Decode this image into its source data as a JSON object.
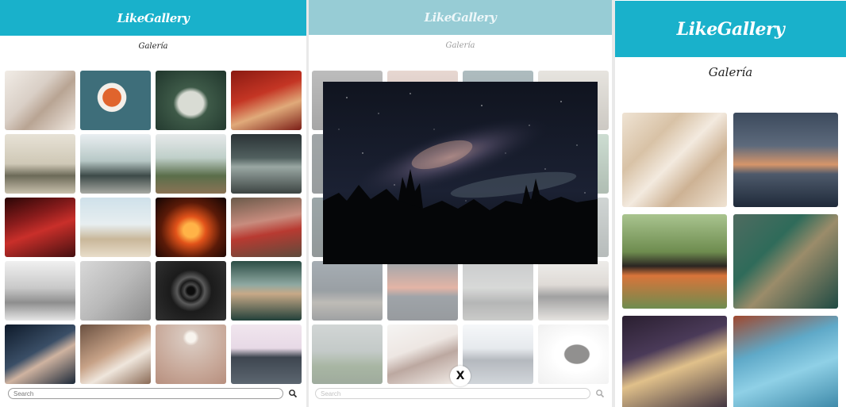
{
  "app": {
    "brand": "LikeGallery",
    "subtitle": "Galería"
  },
  "search": {
    "placeholder": "Search",
    "icon": "search-icon"
  },
  "modal": {
    "close_label": "X",
    "image_subject": "milky way night sky"
  },
  "gallery_desktop": [
    {
      "subject": "skincare products flatlay",
      "bg": "linear-gradient(135deg,#f1ece6 0%,#d9cfc6 40%,#b8a493 60%,#efe7df 100%)"
    },
    {
      "subject": "soup bowl with food",
      "bg": "radial-gradient(circle at 45% 45%,#e0642d 0 18%,#f4efe9 19% 28%,#3e6e7a 29% 100%)"
    },
    {
      "subject": "white owl",
      "bg": "radial-gradient(ellipse at 50% 55%,#d9dcd4 0 25%,#3e5a48 35%,#20362c 100%)"
    },
    {
      "subject": "women on red couch",
      "bg": "linear-gradient(160deg,#8a1a12 0%,#c43524 40%,#e0aa7a 65%,#7b1d16 100%)"
    },
    {
      "subject": "statues on bench",
      "bg": "linear-gradient(180deg,#e7e2d6 0%,#cfc8b6 50%,#6c6a58 70%,#c9c1ad 100%)"
    },
    {
      "subject": "man on motorbike",
      "bg": "linear-gradient(180deg,#e9eef1 0%,#b7c8c6 45%,#3d4a48 70%,#a6a8a2 100%)"
    },
    {
      "subject": "hand with cocktail and palms",
      "bg": "linear-gradient(180deg,#e6e9ea 0%,#bfcfc9 40%,#5a6e4a 70%,#8a7355 100%)"
    },
    {
      "subject": "highway with cars",
      "bg": "linear-gradient(180deg,#2b3336 0%,#51605f 40%,#9aa7a3 55%,#3c4442 100%)"
    },
    {
      "subject": "red car detail",
      "bg": "linear-gradient(160deg,#2a0606 0%,#8b1c1c 35%,#c92f2a 55%,#451010 100%)"
    },
    {
      "subject": "beach fence",
      "bg": "linear-gradient(180deg,#cfe1ea 0%,#e7eef0 45%,#c9b79a 70%,#e8ddca 100%)"
    },
    {
      "subject": "campfire",
      "bg": "radial-gradient(ellipse at 50% 55%,#ffb347 0 15%,#e2531a 30%,#5a1a08 60%,#120503 100%)"
    },
    {
      "subject": "red vintage car",
      "bg": "linear-gradient(170deg,#6b5a4a 0%,#c88c7e 40%,#b83a31 60%,#5e4b3c 100%)"
    },
    {
      "subject": "car logo badge",
      "bg": "linear-gradient(180deg,#f0f0f0 0%,#c9c9c9 45%,#8e8e8e 70%,#e6e6e6 100%)"
    },
    {
      "subject": "bird on branch",
      "bg": "linear-gradient(135deg,#d8d8d8 0%,#b9b9b9 50%,#8c8c8c 100%)"
    },
    {
      "subject": "water drop ripples",
      "bg": "radial-gradient(circle at 50% 50%,#0c0c0c 0 8%,#4a4a4a 14%,#1a1a1a 22%,#5a5a5a 30%,#1b1b1b 45%,#303030 100%)"
    },
    {
      "subject": "motion blur traffic",
      "bg": "linear-gradient(180deg,#2c4d45 0%,#8fa9a2 40%,#c7a987 55%,#22403a 100%)"
    },
    {
      "subject": "person with hands on face",
      "bg": "linear-gradient(150deg,#0e1a2a 0%,#3a4e66 45%,#cfb3a0 60%,#1b2838 100%)"
    },
    {
      "subject": "woman with flowers",
      "bg": "linear-gradient(150deg,#6a5040 0%,#c7a287 45%,#efe6dc 65%,#8a6a55 100%)"
    },
    {
      "subject": "moon at dusk",
      "bg": "radial-gradient(circle at 50% 22%,#f8f4ee 0 8%,#d8c7bd 14%,#c8a99a 60%,#b78f7e 100%)"
    },
    {
      "subject": "building against sky",
      "bg": "linear-gradient(180deg,#f1e6ee 0%,#e7d9e6 40%,#3e4650 55%,#5c6670 100%)"
    }
  ],
  "gallery_modal_bg": [
    {
      "subject": "partial tile",
      "bg": "linear-gradient(180deg,#6b6b6b 0%,#3a3a3a 100%)"
    },
    {
      "subject": "partial tile",
      "bg": "linear-gradient(180deg,#caa79a 0%,#8d6e62 100%)"
    },
    {
      "subject": "partial tile",
      "bg": "linear-gradient(180deg,#4b6b72 0%,#2c3e43 100%)"
    },
    {
      "subject": "partial tile",
      "bg": "linear-gradient(180deg,#c9c3b8 0%,#8f877a 100%)"
    },
    {
      "subject": "partial tile",
      "bg": "linear-gradient(180deg,#2e3a3e 0%,#1b2427 100%)"
    },
    {
      "subject": "partial tile",
      "bg": "linear-gradient(180deg,#6a6a6a 0%,#3b3b3b 100%)"
    },
    {
      "subject": "partial tile",
      "bg": "linear-gradient(180deg,#9c9a92 0%,#6c6a62 100%)"
    },
    {
      "subject": "partial tile",
      "bg": "linear-gradient(180deg,#8fb39a 0%,#4f6d56 100%)"
    },
    {
      "subject": "partial tile",
      "bg": "linear-gradient(180deg,#233b3f 0%,#0f1b1d 100%)"
    },
    {
      "subject": "partial tile",
      "bg": "linear-gradient(180deg,#455254 0%,#1f2627 100%)"
    },
    {
      "subject": "partial tile",
      "bg": "linear-gradient(180deg,#4e5f63 0%,#1e2426 100%)"
    },
    {
      "subject": "partial tile",
      "bg": "linear-gradient(180deg,#98a3a0 0%,#5f6a68 100%)"
    },
    {
      "subject": "coastline dusk",
      "bg": "linear-gradient(180deg,#3a4a58 0%,#1f2c36 50%,#6f6a5e 70%,#2a2f33 100%)"
    },
    {
      "subject": "red clouds sunset",
      "bg": "linear-gradient(180deg,#2a3944 0%,#c25a3a 45%,#2b3540 60%,#1a222a 100%)"
    },
    {
      "subject": "woman in misty field",
      "bg": "linear-gradient(180deg,#8a8e90 0%,#a8aaa8 45%,#5c5e5e 70%,#8b8c88 100%)"
    },
    {
      "subject": "cafe chalkboard sign",
      "bg": "linear-gradient(180deg,#d8d4cf 0%,#b7aea4 40%,#2e2e2e 60%,#c8c2bb 100%)"
    },
    {
      "subject": "person in field",
      "bg": "linear-gradient(180deg,#9aa3a2 0%,#7c8a86 45%,#3f5e34 70%,#2b4527 100%)"
    },
    {
      "subject": "woman with flowers in hair",
      "bg": "linear-gradient(160deg,#e9e7e4 0%,#d8c9c0 40%,#6b3f2e 60%,#e2d6cc 100%)"
    },
    {
      "subject": "woman in cap",
      "bg": "linear-gradient(180deg,#eaeef2 0%,#c8d0d8 40%,#5b6470 60%,#9aa4ae 100%)"
    },
    {
      "subject": "cup of coffee",
      "bg": "radial-gradient(ellipse at 55% 50%,#0d0a08 0 22%,#ffffff 24% 40%,#f2f2f2 60%,#dedede 100%)"
    }
  ],
  "gallery_mobile": [
    {
      "subject": "carved leaves relief",
      "bg": "linear-gradient(135deg,#efe3d3 0%,#d8c2a6 30%,#f3eadf 50%,#cdb294 70%,#efe3d3 100%)"
    },
    {
      "subject": "sunset horizon",
      "bg": "linear-gradient(180deg,#3c4a5d 0%,#5d6a7c 35%,#d6956a 55%,#4e5a6b 65%,#1f2a3a 100%)"
    },
    {
      "subject": "man in floral shirt",
      "bg": "linear-gradient(180deg,#a9c48f 0%,#6e8c4f 40%,#2b2522 55%,#d9743a 65%,#6e8c4f 100%)"
    },
    {
      "subject": "coastal cliffs aerial",
      "bg": "linear-gradient(135deg,#4f6b60 0%,#2f6b5a 35%,#9b8c6a 55%,#1e4a43 100%)"
    },
    {
      "subject": "blonde woman portrait",
      "bg": "linear-gradient(160deg,#2a1f30 0%,#4a3a58 35%,#e0c08a 55%,#3b2f3e 100%)"
    },
    {
      "subject": "street sticker blue wall",
      "bg": "linear-gradient(160deg,#a0482f 0%,#5fa9c8 35%,#8fd0e6 60%,#3a86a6 100%)"
    }
  ],
  "colors": {
    "brand": "#19b1cb",
    "brand_text": "#ffffff",
    "modal_close_bg": "#ffffff"
  }
}
